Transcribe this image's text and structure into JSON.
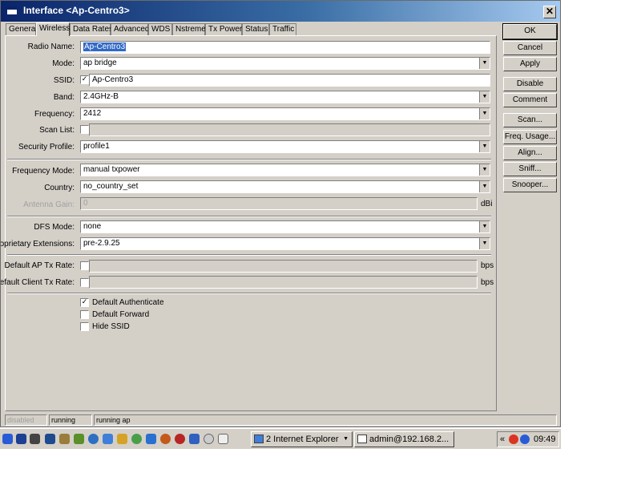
{
  "window": {
    "title": "Interface <Ap-Centro3>",
    "close_glyph": "✕"
  },
  "tabs": [
    "General",
    "Wireless",
    "Data Rates",
    "Advanced",
    "WDS",
    "Nstreme",
    "Tx Power",
    "Status",
    "Traffic"
  ],
  "active_tab": "Wireless",
  "form": {
    "radio_name": {
      "label": "Radio Name:",
      "value": "Ap-Centro3"
    },
    "mode": {
      "label": "Mode:",
      "value": "ap bridge"
    },
    "ssid": {
      "label": "SSID:",
      "value": "Ap-Centro3",
      "checked": true
    },
    "band": {
      "label": "Band:",
      "value": "2.4GHz-B"
    },
    "frequency": {
      "label": "Frequency:",
      "value": "2412"
    },
    "scan_list": {
      "label": "Scan List:",
      "value": ""
    },
    "security_profile": {
      "label": "Security Profile:",
      "value": "profile1"
    },
    "frequency_mode": {
      "label": "Frequency Mode:",
      "value": "manual txpower"
    },
    "country": {
      "label": "Country:",
      "value": "no_country_set"
    },
    "antenna_gain": {
      "label": "Antenna Gain:",
      "value": "0",
      "unit": "dBi"
    },
    "dfs_mode": {
      "label": "DFS Mode:",
      "value": "none"
    },
    "proprietary_extensions": {
      "label": "Proprietary Extensions:",
      "value": "pre-2.9.25"
    },
    "default_ap_tx_rate": {
      "label": "Default AP Tx Rate:",
      "value": "",
      "unit": "bps"
    },
    "default_client_tx_rate": {
      "label": "Default Client Tx Rate:",
      "value": "",
      "unit": "bps"
    },
    "default_authenticate": {
      "label": "Default Authenticate",
      "checked": true
    },
    "default_forward": {
      "label": "Default Forward",
      "checked": false
    },
    "hide_ssid": {
      "label": "Hide SSID",
      "checked": false
    }
  },
  "buttons": {
    "ok": "OK",
    "cancel": "Cancel",
    "apply": "Apply",
    "disable": "Disable",
    "comment": "Comment",
    "scan": "Scan...",
    "freq_usage": "Freq. Usage...",
    "align": "Align...",
    "sniff": "Sniff...",
    "snooper": "Snooper..."
  },
  "status_bar": [
    "disabled",
    "running",
    "running ap"
  ],
  "taskbar": {
    "ie_group": "2 Internet Explorer",
    "terminal": "admin@192.168.2...",
    "clock": "09:49",
    "tray_arrow": "«"
  },
  "glyphs": {
    "check": "✓",
    "dropdown": "▼"
  },
  "colors": {
    "title_start": "#0a246a",
    "title_end": "#a6caf0",
    "face": "#d4d0c8",
    "selection": "#316ac5"
  }
}
